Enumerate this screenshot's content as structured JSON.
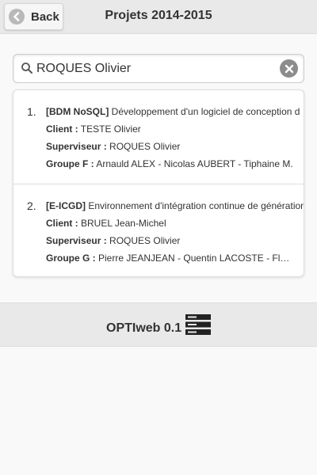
{
  "header": {
    "back_label": "Back",
    "title": "Projets 2014-2015"
  },
  "search": {
    "value": "ROQUES Olivier",
    "placeholder": ""
  },
  "results": [
    {
      "number": "1.",
      "tag": "[BDM NoSQL]",
      "title": "Développement d'un logiciel de conception d",
      "client_label": "Client :",
      "client": "TESTE Olivier",
      "supervisor_label": "Superviseur :",
      "supervisor": "ROQUES Olivier",
      "group_label": "Groupe F :",
      "group": "Arnauld ALEX - Nicolas AUBERT - Tiphaine M."
    },
    {
      "number": "2.",
      "tag": "[E-ICGD]",
      "title": "Environnement d'intégration continue de génération",
      "client_label": "Client :",
      "client": "BRUEL Jean-Michel",
      "supervisor_label": "Superviseur :",
      "supervisor": "ROQUES Olivier",
      "group_label": "Groupe G :",
      "group": "Pierre JEANJEAN - Quentin LACOSTE - Flor..."
    }
  ],
  "footer": {
    "app_name": "OPTIweb 0.1"
  },
  "icons": {
    "back": "chevron-left-icon",
    "search": "search-icon",
    "clear": "clear-icon",
    "footer": "server-icon"
  }
}
